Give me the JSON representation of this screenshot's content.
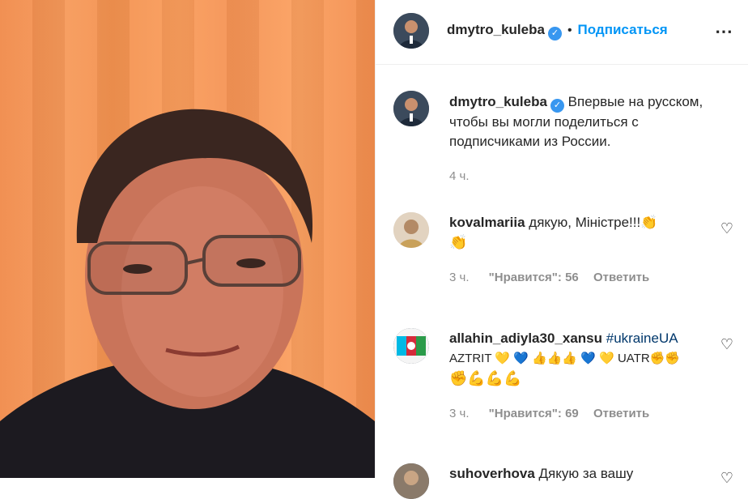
{
  "header": {
    "username": "dmytro_kuleba",
    "follow_label": "Подписаться",
    "more_icon": "⋯"
  },
  "caption": {
    "username": "dmytro_kuleba",
    "text_line1": "Впервые на русском,",
    "text_line2": "чтобы вы могли поделиться с",
    "text_line3": "подписчиками из России.",
    "time": "4 ч."
  },
  "comments": [
    {
      "username": "kovalmariia",
      "text": "дякую, Міністре!!!👏",
      "text2": "👏",
      "time": "3 ч.",
      "likes": "\"Нравится\": 56",
      "reply": "Ответить"
    },
    {
      "username": "allahin_adiyla30_xansu",
      "hashtag": "#ukraineUA",
      "text2": "AZTRIT 💛 💙 👍👍👍 💙 💛 UATR✊✊",
      "text3": "✊💪💪💪",
      "time": "3 ч.",
      "likes": "\"Нравится\": 69",
      "reply": "Ответить"
    },
    {
      "username": "suhoverhova",
      "text": "Дякую за вашу"
    }
  ],
  "colors": {
    "accent": "#0095f6",
    "verified": "#3897f0",
    "muted": "#8e8e8e"
  }
}
